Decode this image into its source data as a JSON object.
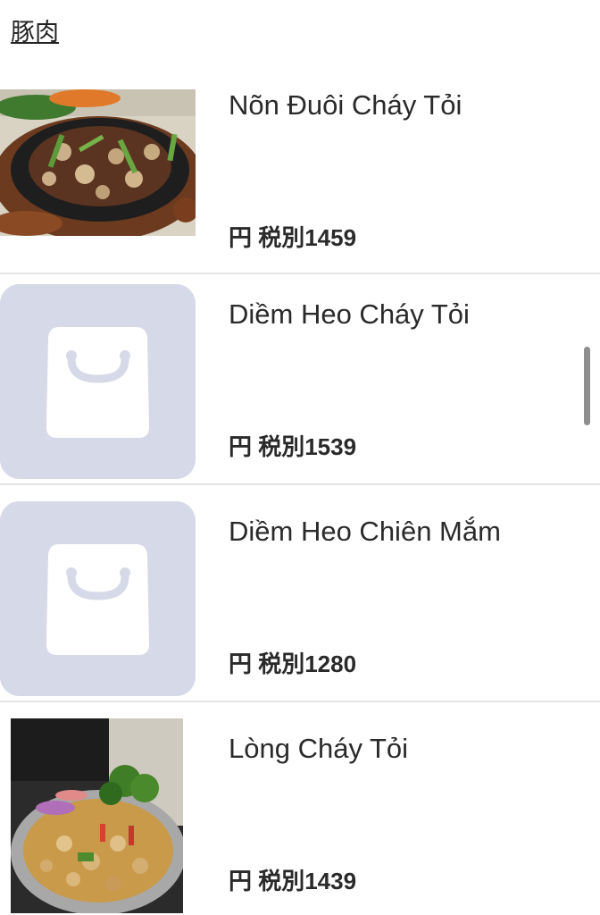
{
  "category": {
    "title": "豚肉"
  },
  "items": [
    {
      "name": "Nõn Đuôi Cháy Tỏi",
      "price": "円 税別1459",
      "image": "photo"
    },
    {
      "name": "Diềm Heo Cháy Tỏi",
      "price": "円 税別1539",
      "image": "placeholder-bag-icon"
    },
    {
      "name": "Diềm Heo Chiên Mắm",
      "price": "円 税別1280",
      "image": "placeholder-bag-icon"
    },
    {
      "name": "Lòng Cháy Tỏi",
      "price": "円 税別1439",
      "image": "photo"
    }
  ],
  "colors": {
    "placeholder_bg": "#d6d9e7",
    "divider": "#e4e4e8",
    "scrollbar": "#8e8e8e"
  }
}
